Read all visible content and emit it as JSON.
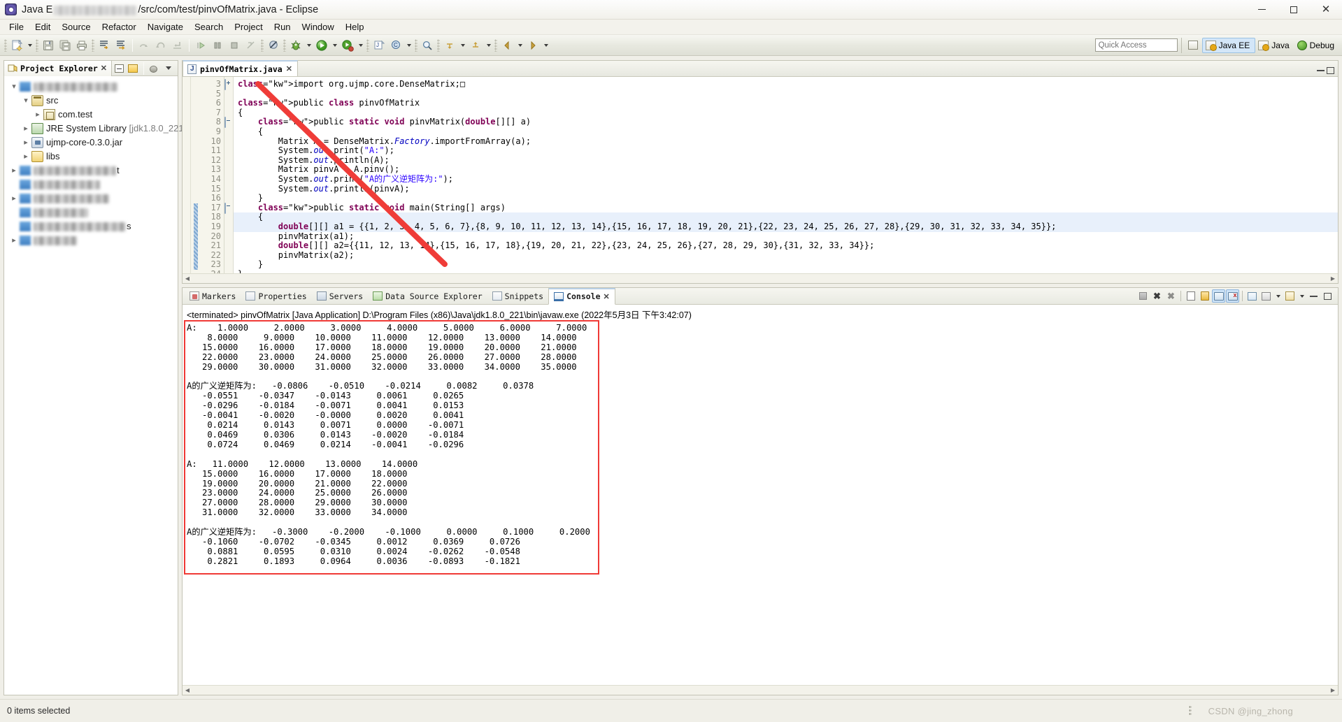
{
  "window": {
    "title_prefix": "Java E",
    "title_suffix": "/src/com/test/pinvOfMatrix.java - Eclipse",
    "minimize": "—",
    "maximize": "□",
    "close": "✕"
  },
  "menubar": {
    "items": [
      "File",
      "Edit",
      "Source",
      "Refactor",
      "Navigate",
      "Search",
      "Project",
      "Run",
      "Window",
      "Help"
    ]
  },
  "toolbar": {
    "quick_access_placeholder": "Quick Access",
    "perspectives": [
      {
        "label": "Java EE",
        "active": true
      },
      {
        "label": "Java",
        "active": false
      },
      {
        "label": "Debug",
        "active": false
      }
    ]
  },
  "explorer": {
    "tab_label": "Project Explorer",
    "close_glyph": "✕",
    "tree": [
      {
        "indent": 0,
        "twisty": "open",
        "icon": "project-icon",
        "label": "",
        "blurred": true,
        "blur_width": 120
      },
      {
        "indent": 1,
        "twisty": "open",
        "icon": "src-icon",
        "label": "src",
        "blurred": false
      },
      {
        "indent": 2,
        "twisty": "closed",
        "icon": "package-icon",
        "label": "com.test",
        "blurred": false
      },
      {
        "indent": 1,
        "twisty": "closed",
        "icon": "jre-icon",
        "label": "JRE System Library ",
        "dim": "[jdk1.8.0_221]",
        "blurred": false
      },
      {
        "indent": 1,
        "twisty": "closed",
        "icon": "jar-icon",
        "label": "ujmp-core-0.3.0.jar",
        "blurred": false
      },
      {
        "indent": 1,
        "twisty": "closed",
        "icon": "folder-icon",
        "label": "libs",
        "blurred": false
      },
      {
        "indent": 0,
        "twisty": "closed",
        "icon": "project-icon",
        "label": "",
        "blurred": true,
        "blur_width": 118,
        "suffix": "t"
      },
      {
        "indent": 0,
        "twisty": "none",
        "icon": "project-icon",
        "label": "",
        "blurred": true,
        "blur_width": 95
      },
      {
        "indent": 0,
        "twisty": "closed",
        "icon": "project-icon",
        "label": "",
        "blurred": true,
        "blur_width": 108
      },
      {
        "indent": 0,
        "twisty": "none",
        "icon": "project-icon",
        "label": "",
        "blurred": true,
        "blur_width": 78
      },
      {
        "indent": 0,
        "twisty": "none",
        "icon": "project-icon",
        "label": "",
        "blurred": true,
        "blur_width": 132,
        "suffix": "s"
      },
      {
        "indent": 0,
        "twisty": "closed",
        "icon": "project-icon",
        "label": "",
        "blurred": true,
        "blur_width": 62
      }
    ]
  },
  "editor": {
    "tab_label": "pinvOfMatrix.java",
    "close_glyph": "✕",
    "lines": [
      {
        "no": "3",
        "fold": "plus",
        "changed": false,
        "hl": false,
        "text": "import org.ujmp.core.DenseMatrix;□",
        "kw_prefix": "import"
      },
      {
        "no": "5",
        "fold": "",
        "changed": false,
        "hl": false,
        "text": ""
      },
      {
        "no": "6",
        "fold": "",
        "changed": false,
        "hl": false,
        "text": "public class pinvOfMatrix"
      },
      {
        "no": "7",
        "fold": "",
        "changed": false,
        "hl": false,
        "text": "{"
      },
      {
        "no": "8",
        "fold": "minus",
        "changed": false,
        "hl": false,
        "text": "    public static void pinvMatrix(double[][] a)"
      },
      {
        "no": "9",
        "fold": "",
        "changed": false,
        "hl": false,
        "text": "    {"
      },
      {
        "no": "10",
        "fold": "",
        "changed": false,
        "hl": false,
        "text": "        Matrix A = DenseMatrix.Factory.importFromArray(a);"
      },
      {
        "no": "11",
        "fold": "",
        "changed": false,
        "hl": false,
        "text": "        System.out.print(\"A:\");"
      },
      {
        "no": "12",
        "fold": "",
        "changed": false,
        "hl": false,
        "text": "        System.out.println(A);"
      },
      {
        "no": "13",
        "fold": "",
        "changed": false,
        "hl": false,
        "text": "        Matrix pinvA = A.pinv();"
      },
      {
        "no": "14",
        "fold": "",
        "changed": false,
        "hl": false,
        "text": "        System.out.print(\"A的广义逆矩阵为:\");"
      },
      {
        "no": "15",
        "fold": "",
        "changed": false,
        "hl": false,
        "text": "        System.out.println(pinvA);"
      },
      {
        "no": "16",
        "fold": "",
        "changed": false,
        "hl": false,
        "text": "    }"
      },
      {
        "no": "17",
        "fold": "minus",
        "changed": true,
        "hl": false,
        "text": "    public static void main(String[] args)"
      },
      {
        "no": "18",
        "fold": "",
        "changed": true,
        "hl": true,
        "text": "    {"
      },
      {
        "no": "19",
        "fold": "",
        "changed": true,
        "hl": true,
        "text": "        double[][] a1 = {{1, 2, 3, 4, 5, 6, 7},{8, 9, 10, 11, 12, 13, 14},{15, 16, 17, 18, 19, 20, 21},{22, 23, 24, 25, 26, 27, 28},{29, 30, 31, 32, 33, 34, 35}};"
      },
      {
        "no": "20",
        "fold": "",
        "changed": true,
        "hl": false,
        "text": "        pinvMatrix(a1);"
      },
      {
        "no": "21",
        "fold": "",
        "changed": true,
        "hl": false,
        "text": "        double[][] a2={{11, 12, 13, 14},{15, 16, 17, 18},{19, 20, 21, 22},{23, 24, 25, 26},{27, 28, 29, 30},{31, 32, 33, 34}};"
      },
      {
        "no": "22",
        "fold": "",
        "changed": true,
        "hl": false,
        "text": "        pinvMatrix(a2);"
      },
      {
        "no": "23",
        "fold": "",
        "changed": true,
        "hl": false,
        "text": "    }"
      },
      {
        "no": "24",
        "fold": "",
        "changed": false,
        "hl": false,
        "text": "}"
      }
    ]
  },
  "console": {
    "tabs": [
      {
        "label": "Markers",
        "icon": "markers-icon",
        "active": false
      },
      {
        "label": "Properties",
        "icon": "properties-icon",
        "active": false
      },
      {
        "label": "Servers",
        "icon": "servers-icon",
        "active": false
      },
      {
        "label": "Data Source Explorer",
        "icon": "database-icon",
        "active": false
      },
      {
        "label": "Snippets",
        "icon": "snippets-icon",
        "active": false
      },
      {
        "label": "Console",
        "icon": "console-icon",
        "active": true
      }
    ],
    "close_glyph": "✕",
    "terminated_line": "<terminated> pinvOfMatrix [Java Application] D:\\Program Files (x86)\\Java\\jdk1.8.0_221\\bin\\javaw.exe (2022年5月3日 下午3:42:07)",
    "output": "A:    1.0000     2.0000     3.0000     4.0000     5.0000     6.0000     7.0000\n    8.0000     9.0000    10.0000    11.0000    12.0000    13.0000    14.0000\n   15.0000    16.0000    17.0000    18.0000    19.0000    20.0000    21.0000\n   22.0000    23.0000    24.0000    25.0000    26.0000    27.0000    28.0000\n   29.0000    30.0000    31.0000    32.0000    33.0000    34.0000    35.0000\n\nA的广义逆矩阵为:   -0.0806    -0.0510    -0.0214     0.0082     0.0378\n   -0.0551    -0.0347    -0.0143     0.0061     0.0265\n   -0.0296    -0.0184    -0.0071     0.0041     0.0153\n   -0.0041    -0.0020    -0.0000     0.0020     0.0041\n    0.0214     0.0143     0.0071     0.0000    -0.0071\n    0.0469     0.0306     0.0143    -0.0020    -0.0184\n    0.0724     0.0469     0.0214    -0.0041    -0.0296\n\nA:   11.0000    12.0000    13.0000    14.0000\n   15.0000    16.0000    17.0000    18.0000\n   19.0000    20.0000    21.0000    22.0000\n   23.0000    24.0000    25.0000    26.0000\n   27.0000    28.0000    29.0000    30.0000\n   31.0000    32.0000    33.0000    34.0000\n\nA的广义逆矩阵为:   -0.3000    -0.2000    -0.1000     0.0000     0.1000     0.2000\n   -0.1060    -0.0702    -0.0345     0.0012     0.0369     0.0726\n    0.0881     0.0595     0.0310     0.0024    -0.0262    -0.0548\n    0.2821     0.1893     0.0964     0.0036    -0.0893    -0.1821"
  },
  "statusbar": {
    "selection_text": "0 items selected",
    "watermark": "CSDN @jing_zhong"
  },
  "colors": {
    "accent_red": "#f03a36",
    "tab_blue": "#b8cfe5",
    "keyword": "#7f0055",
    "string": "#2a00ff",
    "field": "#0000c0",
    "linenum": "#8f8f83"
  }
}
